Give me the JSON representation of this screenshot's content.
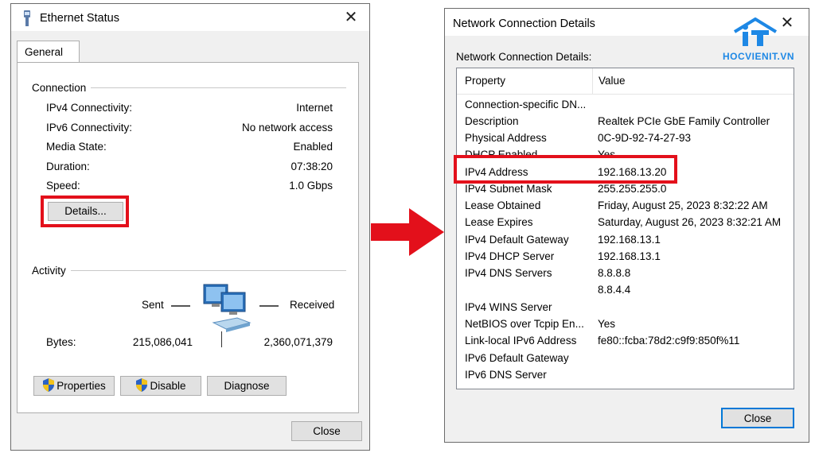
{
  "ethernet_status": {
    "title": "Ethernet Status",
    "tab": "General",
    "connection_label": "Connection",
    "rows": [
      {
        "label": "IPv4 Connectivity:",
        "value": "Internet"
      },
      {
        "label": "IPv6 Connectivity:",
        "value": "No network access"
      },
      {
        "label": "Media State:",
        "value": "Enabled"
      },
      {
        "label": "Duration:",
        "value": "07:38:20"
      },
      {
        "label": "Speed:",
        "value": "1.0 Gbps"
      }
    ],
    "details_button": "Details...",
    "activity_label": "Activity",
    "sent_label": "Sent",
    "received_label": "Received",
    "bytes_label": "Bytes:",
    "bytes_sent": "215,086,041",
    "bytes_received": "2,360,071,379",
    "properties_button": "Properties",
    "disable_button": "Disable",
    "diagnose_button": "Diagnose",
    "close_button": "Close"
  },
  "details_window": {
    "title": "Network Connection Details",
    "section_label": "Network Connection Details:",
    "col_property": "Property",
    "col_value": "Value",
    "rows": [
      {
        "property": "Connection-specific DN...",
        "value": ""
      },
      {
        "property": "Description",
        "value": "Realtek PCIe GbE Family Controller"
      },
      {
        "property": "Physical Address",
        "value": "0C-9D-92-74-27-93"
      },
      {
        "property": "DHCP Enabled",
        "value": "Yes"
      },
      {
        "property": "IPv4 Address",
        "value": "192.168.13.20"
      },
      {
        "property": "IPv4 Subnet Mask",
        "value": "255.255.255.0"
      },
      {
        "property": "Lease Obtained",
        "value": "Friday, August 25, 2023 8:32:22 AM"
      },
      {
        "property": "Lease Expires",
        "value": "Saturday, August 26, 2023 8:32:21 AM"
      },
      {
        "property": "IPv4 Default Gateway",
        "value": "192.168.13.1"
      },
      {
        "property": "IPv4 DHCP Server",
        "value": "192.168.13.1"
      },
      {
        "property": "IPv4 DNS Servers",
        "value": "8.8.8.8"
      },
      {
        "property": "",
        "value": "8.8.4.4"
      },
      {
        "property": "IPv4 WINS Server",
        "value": ""
      },
      {
        "property": "NetBIOS over Tcpip En...",
        "value": "Yes"
      },
      {
        "property": "Link-local IPv6 Address",
        "value": "fe80::fcba:78d2:c9f9:850f%11"
      },
      {
        "property": "IPv6 Default Gateway",
        "value": ""
      },
      {
        "property": "IPv6 DNS Server",
        "value": ""
      }
    ],
    "close_button": "Close"
  },
  "logo": {
    "text": "HOCVIENIT.VN",
    "mark": "iT"
  },
  "colors": {
    "highlight": "#e3101b",
    "arrow": "#e3101b",
    "logo": "#1e88e5"
  },
  "icons": [
    "ethernet-icon",
    "close-icon",
    "shield-icon",
    "network-computers-icon",
    "arrow-right-icon"
  ]
}
